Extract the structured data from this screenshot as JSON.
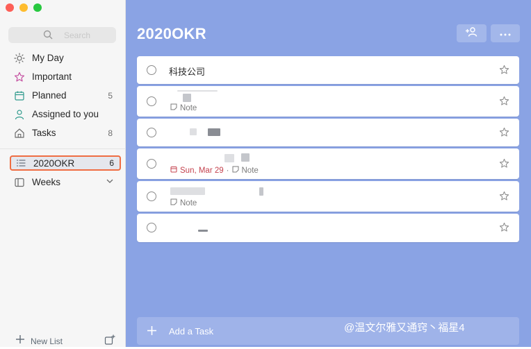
{
  "window": {
    "traffic_lights": [
      "#fd5f57",
      "#febc2e",
      "#28c840"
    ]
  },
  "sidebar": {
    "search_placeholder": "Search",
    "items": [
      {
        "label": "My Day",
        "icon": "sun-icon",
        "count": ""
      },
      {
        "label": "Important",
        "icon": "star-icon",
        "count": ""
      },
      {
        "label": "Planned",
        "icon": "calendar-icon",
        "count": "5"
      },
      {
        "label": "Assigned to you",
        "icon": "person-icon",
        "count": ""
      },
      {
        "label": "Tasks",
        "icon": "home-icon",
        "count": "8"
      }
    ],
    "lists": [
      {
        "label": "2020OKR",
        "icon": "list-icon",
        "count": "6",
        "active": true
      },
      {
        "label": "Weeks",
        "icon": "group-icon",
        "collapsed_chevron": "chevron-down-icon"
      }
    ],
    "new_list_label": "New List"
  },
  "main": {
    "title": "2020OKR",
    "accent": "#8aa3e4",
    "tasks": [
      {
        "title": "科技公司",
        "note": "",
        "due": ""
      },
      {
        "title": "",
        "note": "Note",
        "due": ""
      },
      {
        "title": "",
        "note": "",
        "due": ""
      },
      {
        "title": "",
        "note": "Note",
        "due": "Sun, Mar 29",
        "separator": "·"
      },
      {
        "title": "",
        "note": "Note",
        "due": ""
      },
      {
        "title": "",
        "note": "",
        "due": ""
      }
    ],
    "add_task_label": "Add a Task"
  },
  "watermark": {
    "text": "@温文尔雅又通窍丶福星4"
  }
}
